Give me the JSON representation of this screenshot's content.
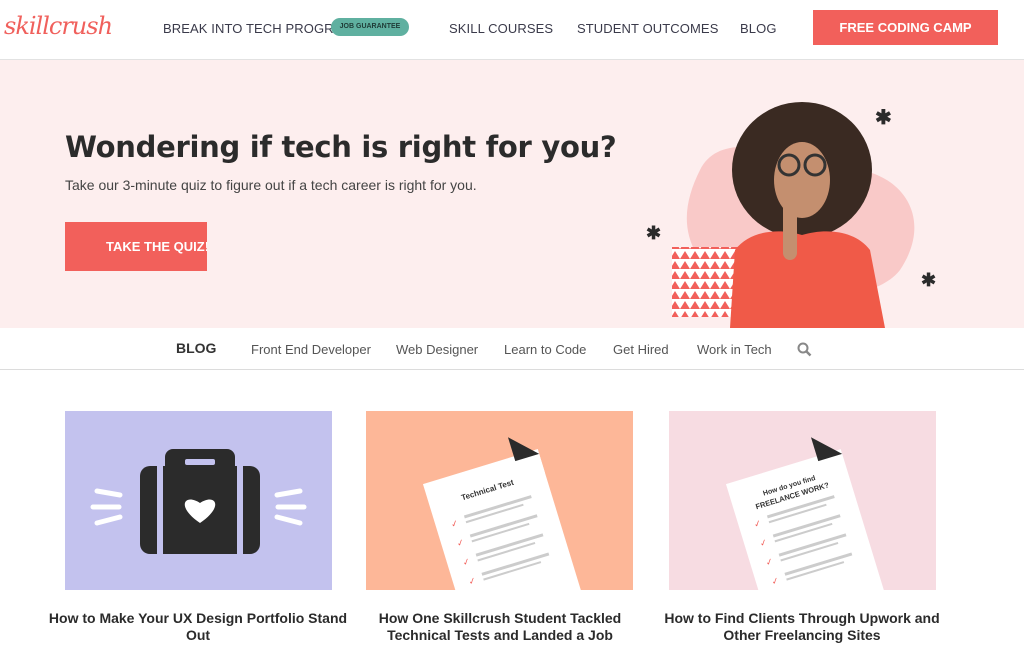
{
  "nav": {
    "logo": "skillcrush",
    "items": [
      {
        "label": "BREAK INTO TECH PROGRAM",
        "badge": "JOB GUARANTEE"
      },
      {
        "label": "SKILL COURSES"
      },
      {
        "label": "STUDENT OUTCOMES"
      },
      {
        "label": "BLOG"
      }
    ],
    "cta": "FREE CODING CAMP"
  },
  "hero": {
    "title": "Wondering if tech is right for you?",
    "subtitle": "Take our 3-minute quiz to figure out if a tech career is right for you.",
    "button": "TAKE THE QUIZ!"
  },
  "blog_nav": {
    "title": "BLOG",
    "items": [
      "Front End Developer",
      "Web Designer",
      "Learn to Code",
      "Get Hired",
      "Work in Tech"
    ],
    "search_icon": "search-icon"
  },
  "cards": [
    {
      "title": "How to Make Your UX Design Portfolio Stand Out",
      "bg": "#c3c2ee"
    },
    {
      "title": "How One Skillcrush Student Tackled Technical Tests and Landed a Job",
      "bg": "#fdb798",
      "doc_title": "Technical Test"
    },
    {
      "title": "How to Find Clients Through Upwork and Other Freelancing Sites",
      "bg": "#f7dce2",
      "doc_title_1": "How do you find",
      "doc_title_2": "FREELANCE WORK?"
    }
  ],
  "colors": {
    "accent": "#f2605b",
    "badge": "#5fb0a0",
    "hero_bg": "#fdeeee"
  }
}
